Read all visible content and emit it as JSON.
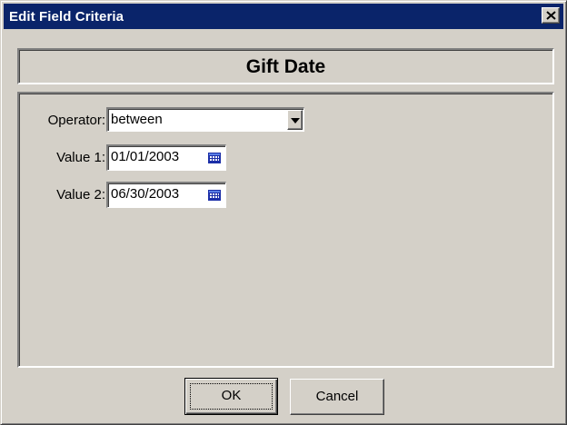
{
  "window": {
    "title": "Edit Field Criteria",
    "close_icon": "close-icon"
  },
  "header": {
    "title": "Gift Date"
  },
  "criteria": {
    "operator_label": "Operator:",
    "operator_value": "between",
    "value1_label": "Value 1:",
    "value1": "01/01/2003",
    "value2_label": "Value 2:",
    "value2": "06/30/2003",
    "calendar_icon": "calendar-icon",
    "dropdown_icon": "chevron-down-icon"
  },
  "buttons": {
    "ok": "OK",
    "cancel": "Cancel"
  },
  "colors": {
    "title_bar": "#0a246a",
    "dialog_face": "#d4d0c8",
    "calendar_icon": "#1c2fa8"
  }
}
